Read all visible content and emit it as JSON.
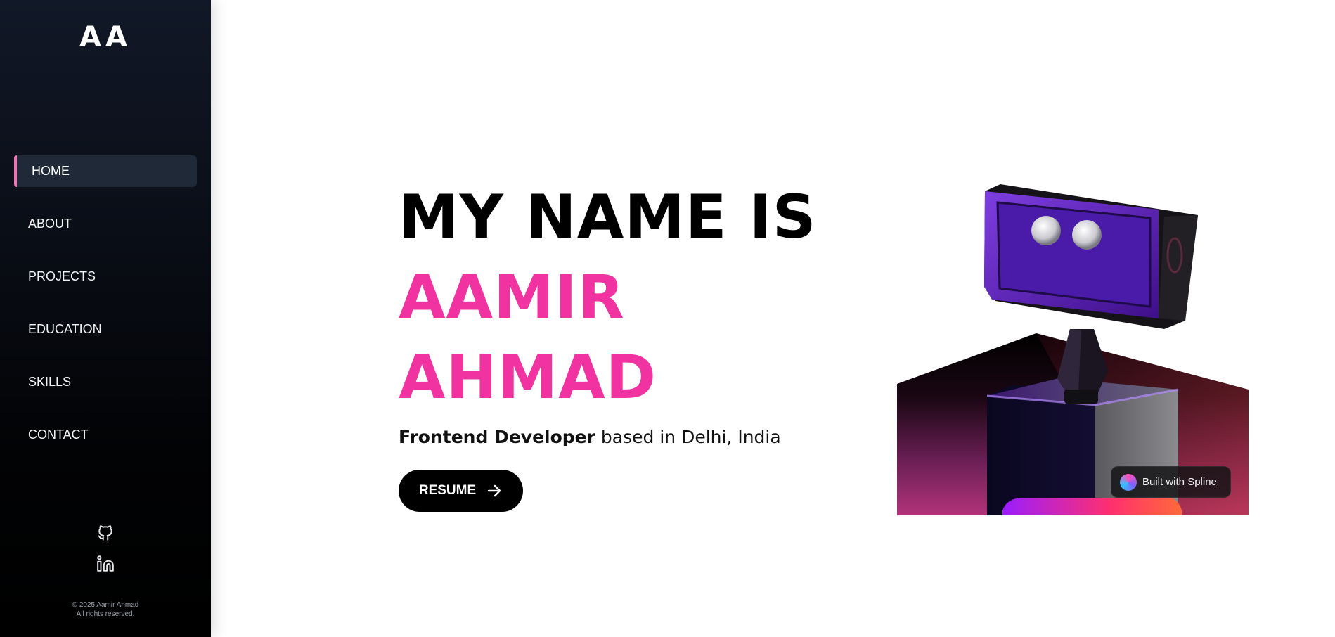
{
  "sidebar": {
    "logo": "AA",
    "nav": [
      {
        "label": "HOME",
        "active": true
      },
      {
        "label": "ABOUT",
        "active": false
      },
      {
        "label": "PROJECTS",
        "active": false
      },
      {
        "label": "EDUCATION",
        "active": false
      },
      {
        "label": "SKILLS",
        "active": false
      },
      {
        "label": "CONTACT",
        "active": false
      }
    ],
    "social": [
      {
        "icon": "github-icon"
      },
      {
        "icon": "linkedin-icon"
      }
    ],
    "copyright_line1": "© 2025 Aamir Ahmad",
    "copyright_line2": "All rights reserved."
  },
  "hero": {
    "heading_line1": "MY NAME IS",
    "name_line1": "AAMIR",
    "name_line2": "AHMAD",
    "role": "Frontend Developer",
    "location_text": "based in Delhi, India",
    "resume_label": "RESUME"
  },
  "scene": {
    "badge_label": "Built with Spline"
  },
  "colors": {
    "accent": "#f133a1",
    "sidebar_active_bar": "#f472b6",
    "sidebar_active_bg": "#1f2937",
    "button_bg": "#000000"
  }
}
